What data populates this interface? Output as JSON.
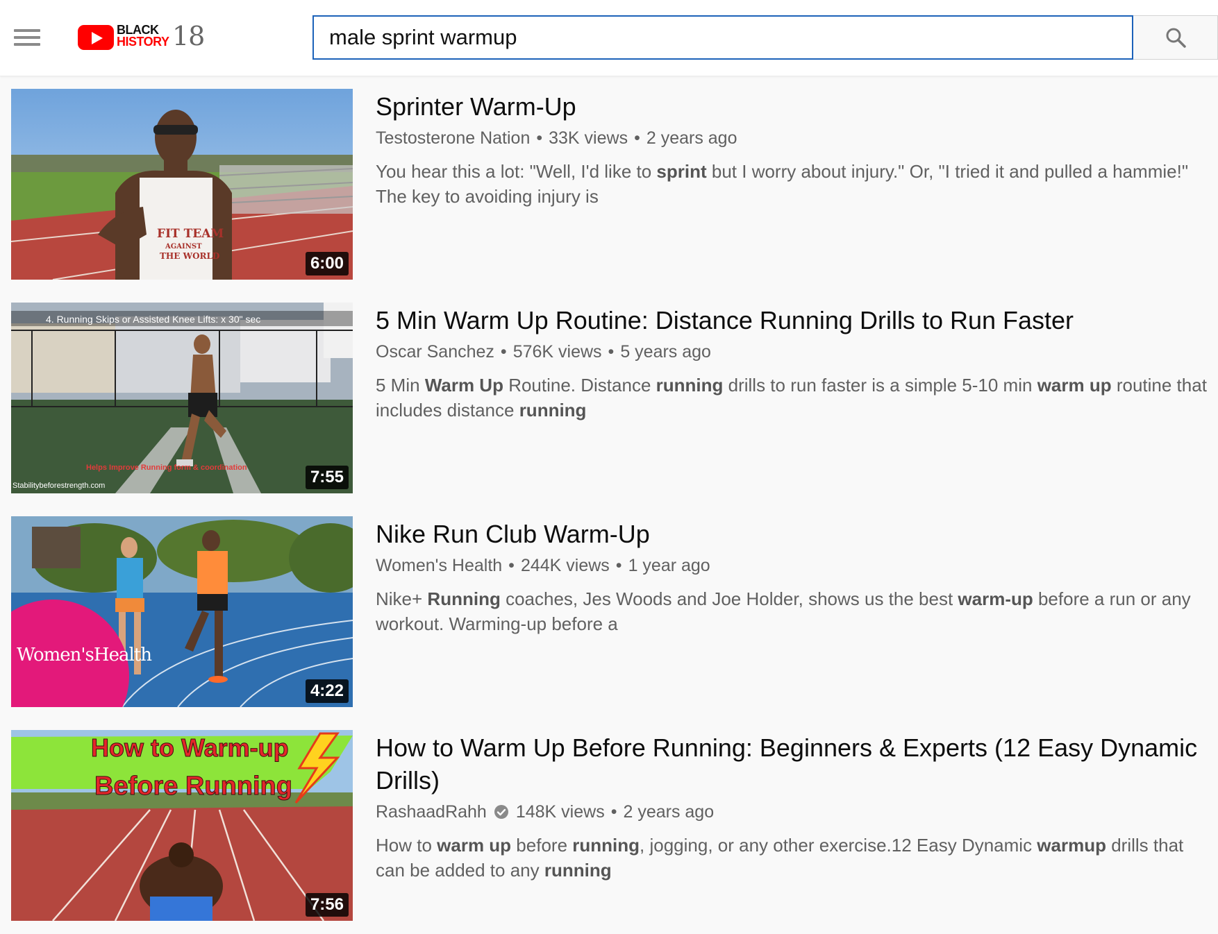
{
  "header": {
    "logo_line1": "BLACK",
    "logo_line2": "HISTORY",
    "logo_year": "18",
    "search_value": "male sprint warmup"
  },
  "results": [
    {
      "title": "Sprinter Warm-Up",
      "channel": "Testosterone Nation",
      "views": "33K views",
      "age": "2 years ago",
      "verified": false,
      "duration": "6:00",
      "description_html": "You hear this a lot: \"Well, I'd like to <b>sprint</b> but I worry about injury.\" Or, \"I tried it and pulled a hammie!\" The key to avoiding injury is",
      "thumb_text": [
        "FIT TEAM",
        "AGAINST",
        "THE WORLD"
      ]
    },
    {
      "title": "5 Min Warm Up Routine: Distance Running Drills to Run Faster",
      "channel": "Oscar Sanchez",
      "views": "576K views",
      "age": "5 years ago",
      "verified": false,
      "duration": "7:55",
      "description_html": "5 Min <b>Warm Up</b> Routine. Distance <b>running</b> drills to run faster is a simple 5-10 min <b>warm up</b> routine that includes distance <b>running</b>",
      "thumb_text": [
        "4. Running Skips or Assisted Knee Lifts: x 30\" sec",
        "Helps Improve Running form & coordination",
        "Stabilitybeforestrength.com"
      ]
    },
    {
      "title": "Nike Run Club Warm-Up",
      "channel": "Women's Health",
      "views": "244K views",
      "age": "1 year ago",
      "verified": false,
      "duration": "4:22",
      "description_html": "Nike+ <b>Running</b> coaches, Jes Woods and Joe Holder, shows us the best <b>warm-up</b> before a run or any workout. Warming-up before a",
      "thumb_text": [
        "Women'sHealth"
      ]
    },
    {
      "title": "How to Warm Up Before Running: Beginners & Experts (12 Easy Dynamic Drills)",
      "channel": "RashaadRahh",
      "views": "148K views",
      "age": "2 years ago",
      "verified": true,
      "duration": "7:56",
      "description_html": "How to <b>warm up</b> before <b>running</b>, jogging, or any other exercise.12 Easy Dynamic <b>warmup</b> drills that can be added to any <b>running</b>",
      "thumb_text": [
        "How to Warm-up",
        "Before Running"
      ]
    }
  ],
  "colors": {
    "accent": "#1c62b9",
    "brand_red": "#ff0000",
    "meta_gray": "#606060"
  },
  "icons": [
    "menu-icon",
    "youtube-logo",
    "search-icon",
    "verified-check-icon"
  ]
}
